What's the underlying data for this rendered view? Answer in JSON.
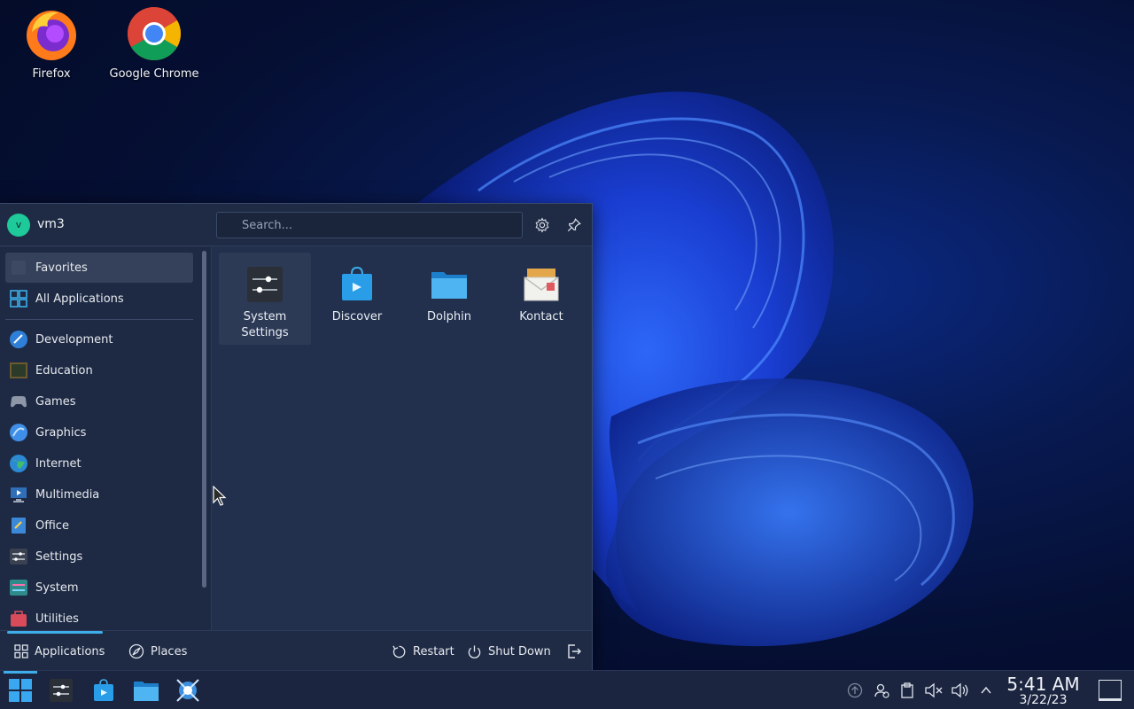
{
  "desktop": {
    "icons": [
      {
        "label": "Firefox",
        "icon": "firefox-icon"
      },
      {
        "label": "Google Chrome",
        "icon": "chrome-icon"
      }
    ]
  },
  "launcher": {
    "user": {
      "initial": "v",
      "name": "vm3"
    },
    "search": {
      "placeholder": "Search..."
    },
    "sidebar": {
      "items": [
        {
          "label": "Favorites",
          "icon": "star-icon"
        },
        {
          "label": "All Applications",
          "icon": "grid-icon"
        },
        {
          "label": "Development",
          "icon": "development-icon"
        },
        {
          "label": "Education",
          "icon": "education-icon"
        },
        {
          "label": "Games",
          "icon": "gamepad-icon"
        },
        {
          "label": "Graphics",
          "icon": "graphics-icon"
        },
        {
          "label": "Internet",
          "icon": "globe-icon"
        },
        {
          "label": "Multimedia",
          "icon": "multimedia-icon"
        },
        {
          "label": "Office",
          "icon": "office-icon"
        },
        {
          "label": "Settings",
          "icon": "settings-icon"
        },
        {
          "label": "System",
          "icon": "system-icon"
        },
        {
          "label": "Utilities",
          "icon": "utilities-icon"
        }
      ]
    },
    "apps": [
      {
        "label": "System Settings",
        "icon": "system-settings-icon"
      },
      {
        "label": "Discover",
        "icon": "discover-icon"
      },
      {
        "label": "Dolphin",
        "icon": "dolphin-folder-icon"
      },
      {
        "label": "Kontact",
        "icon": "kontact-icon"
      }
    ],
    "footer": {
      "tabs": [
        {
          "label": "Applications",
          "icon": "grid-icon"
        },
        {
          "label": "Places",
          "icon": "compass-icon"
        }
      ],
      "restart_label": "Restart",
      "shutdown_label": "Shut Down"
    }
  },
  "taskbar": {
    "clock": {
      "time": "5:41 AM",
      "date": "3/22/23"
    }
  },
  "colors": {
    "accent": "#3daee9",
    "panel": "#22304d",
    "sidebar": "#1e2a44"
  }
}
